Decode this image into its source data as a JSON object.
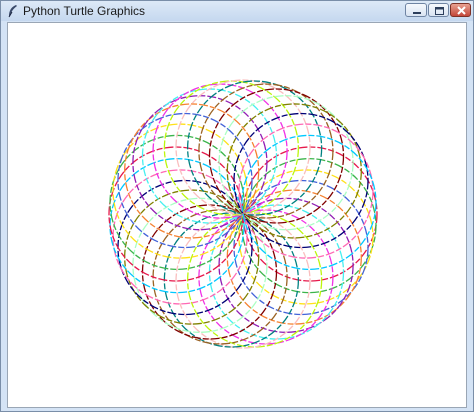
{
  "window": {
    "title": "Python Turtle Graphics",
    "icon": "feather-icon",
    "controls": {
      "minimize": "minimize-icon",
      "maximize": "maximize-icon",
      "close": "close-icon"
    }
  },
  "drawing": {
    "shape": "spirograph-circles",
    "circle_count": 36,
    "palette": [
      "#e6194b",
      "#3cb44b",
      "#ffe119",
      "#4363d8",
      "#f58231",
      "#911eb4",
      "#46f0f0",
      "#f032e6",
      "#bcf60c",
      "#fabebe",
      "#008080",
      "#9a6324",
      "#800000",
      "#aaffc3",
      "#808000",
      "#000075",
      "#ff69b4",
      "#00c8ff"
    ]
  }
}
